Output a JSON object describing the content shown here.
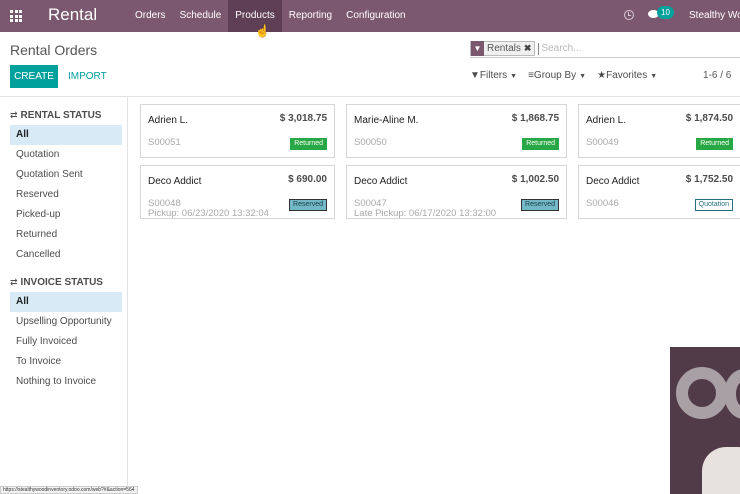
{
  "navbar": {
    "app_name": "Rental",
    "menu": [
      {
        "label": "Orders"
      },
      {
        "label": "Schedule"
      },
      {
        "label": "Products"
      },
      {
        "label": "Reporting"
      },
      {
        "label": "Configuration"
      }
    ],
    "active_menu": "Products",
    "chat_count": "10",
    "user": "Stealthy Wo",
    "background_color": "#7c5870"
  },
  "page": {
    "title": "Rental Orders",
    "create_label": "CREATE",
    "import_label": "IMPORT",
    "accent_color": "#00a09d"
  },
  "search": {
    "facet": "Rentals",
    "placeholder": "Search..."
  },
  "controls": {
    "filters": "Filters",
    "group_by": "Group By",
    "favorites": "Favorites",
    "pager": "1-6 / 6"
  },
  "sidebar": {
    "rental_status": {
      "title": "RENTAL STATUS",
      "items": [
        "All",
        "Quotation",
        "Quotation Sent",
        "Reserved",
        "Picked-up",
        "Returned",
        "Cancelled"
      ],
      "selected": "All"
    },
    "invoice_status": {
      "title": "INVOICE STATUS",
      "items": [
        "All",
        "Upselling Opportunity",
        "Fully Invoiced",
        "To Invoice",
        "Nothing to Invoice"
      ],
      "selected": "All"
    }
  },
  "cards": [
    {
      "customer": "Adrien L.",
      "amount": "$ 3,018.75",
      "ref": "S00051",
      "pickup": "",
      "status": "Returned"
    },
    {
      "customer": "Marie-Aline M.",
      "amount": "$ 1,868.75",
      "ref": "S00050",
      "pickup": "",
      "status": "Returned"
    },
    {
      "customer": "Adrien L.",
      "amount": "$ 1,874.50",
      "ref": "S00049",
      "pickup": "",
      "status": "Returned"
    },
    {
      "customer": "Deco Addict",
      "amount": "$ 690.00",
      "ref": "S00048",
      "pickup": "Pickup: 06/23/2020 13:32:04",
      "status": "Reserved"
    },
    {
      "customer": "Deco Addict",
      "amount": "$ 1,002.50",
      "ref": "S00047",
      "pickup": "Late Pickup: 06/17/2020 13:32:00",
      "status": "Reserved"
    },
    {
      "customer": "Deco Addict",
      "amount": "$ 1,752.50",
      "ref": "S00046",
      "pickup": "",
      "status": "Quotation"
    }
  ],
  "status_url": "https://stealthywoodinventory.odoo.com/web?#&action=564"
}
